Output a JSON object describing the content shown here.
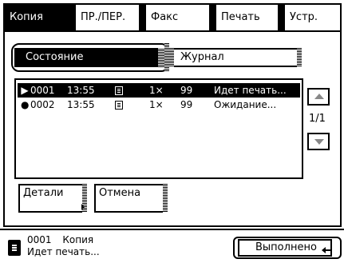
{
  "tabs": [
    {
      "label": "Копия",
      "active": true
    },
    {
      "label": "ПР./ПЕР.",
      "active": false
    },
    {
      "label": "Факс",
      "active": false
    },
    {
      "label": "Печать",
      "active": false
    },
    {
      "label": "Устр.",
      "active": false
    }
  ],
  "mode_buttons": {
    "status": "Состояние",
    "journal": "Журнал"
  },
  "jobs": [
    {
      "marker": "▶",
      "number": "0001",
      "time": "13:55",
      "copies": "1×",
      "pages": "99",
      "status": "Идет печать...",
      "selected": true
    },
    {
      "marker": "●",
      "number": "0002",
      "time": "13:55",
      "copies": "1×",
      "pages": "99",
      "status": "Ожидание...",
      "selected": false
    }
  ],
  "pagination": {
    "indicator": "1/1"
  },
  "actions": {
    "details": "Детали",
    "cancel": "Отмена"
  },
  "footer": {
    "job_number": "0001",
    "job_type": "Копия",
    "job_status": "Идет печать...",
    "done_button": "Выполнено"
  },
  "colors": {
    "foreground": "#000000",
    "background": "#ffffff",
    "disabled_arrow": "#888888"
  }
}
